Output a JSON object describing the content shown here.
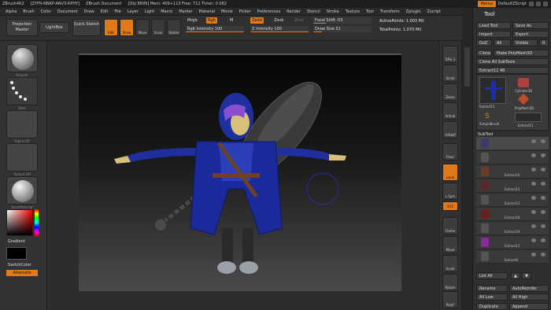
{
  "titlebar": {
    "app": "ZBrush4R2",
    "project": "[ZYFR-NNKP-ANV3-KPHY]",
    "document": "ZBrush Document",
    "stats": "[Obj 8899] Mem: 409+113 Free: 712 Timer: 0.082",
    "menus_button": "Menus",
    "script_label": "DefaultZScript"
  },
  "menubar": {
    "items": [
      "Alpha",
      "Brush",
      "Color",
      "Document",
      "Draw",
      "Edit",
      "File",
      "Layer",
      "Light",
      "Macro",
      "Marker",
      "Material",
      "Movie",
      "Picker",
      "Preferences",
      "Render",
      "Stencil",
      "Stroke",
      "Texture",
      "Tool",
      "Transform",
      "Zplugin",
      "Zscript"
    ]
  },
  "toolbar": {
    "projection_master": "Projection Master",
    "lightbox": "LightBox",
    "quick_sketch": "Quick Sketch",
    "edit": "Edit",
    "draw": "Draw",
    "move": "Move",
    "scale": "Scale",
    "rotate": "Rotate",
    "mrgb": "Mrgb",
    "rgb": "Rgb",
    "m": "M",
    "zadd": "Zadd",
    "zsub": "Zsub",
    "zcut": "Zcut",
    "rgb_intensity": "Rgb Intensity 100",
    "z_intensity": "Z Intensity 100",
    "focal_shift": "Focal Shift -55",
    "draw_size": "Draw Size 51",
    "active_points": "ActivePoints: 1.003 Mil",
    "total_points": "TotalPoints: 1.070 Mil"
  },
  "leftpanel": {
    "brush_label": "Smooth",
    "stroke_label": "Dots",
    "alpha_label": "Alpha Off",
    "texture_label": "Texture Off",
    "material_label": "BasicMaterial",
    "gradient_label": "Gradient",
    "switch_color": "SwitchColor",
    "alternate": "Alternate"
  },
  "rightshelf": {
    "items": [
      "SPix 3",
      "Scroll",
      "Zoom",
      "Actual",
      "AAHalf",
      "Floor",
      "Local",
      "L.Sym",
      "XYZ",
      "Frame",
      "Move",
      "Scale",
      "Rotate",
      "PolyF"
    ]
  },
  "toolpanel": {
    "title": "Tool",
    "load_tool": "Load Tool",
    "save_as": "Save As",
    "import": "Import",
    "export": "Export",
    "goz": "GoZ",
    "all": "All",
    "visible": "Visible",
    "r": "R",
    "clone": "Clone",
    "make_polymesh": "Make PolyMesh3D",
    "clone_all_subtools": "Clone All SubTools",
    "extract_slider": "Extract11 48",
    "tool_thumbs": [
      "Extract11",
      "Cylinder3D",
      "PolyMesh3D",
      "SimpleBrush",
      "Extract11"
    ],
    "subtool_header": "SubTool",
    "subtools": [
      "",
      "",
      "Extract10",
      "Extract12",
      "Extract13",
      "Extract18",
      "Extract19",
      "Extract11",
      "Extract8"
    ],
    "list_all": "List All",
    "rename": "Rename",
    "autoreorder": "AutoReorder",
    "all_low": "All Low",
    "all_high": "All High",
    "duplicate": "Duplicate",
    "append": "Append"
  }
}
